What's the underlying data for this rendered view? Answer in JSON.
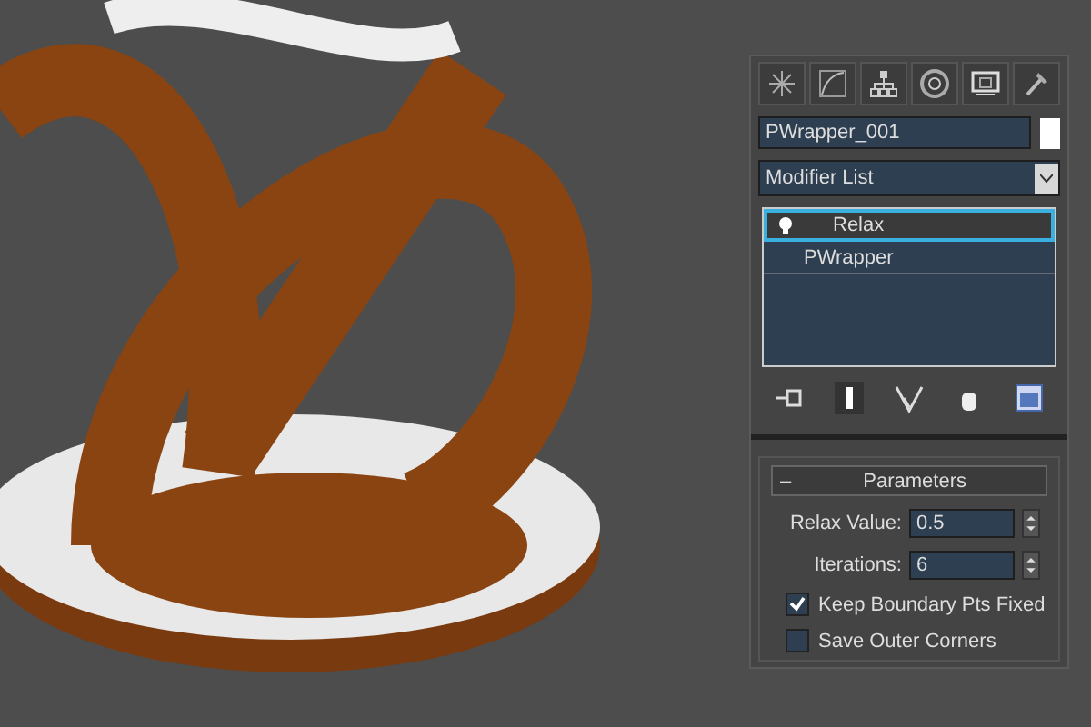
{
  "object_name": "PWrapper_001",
  "modifier_list": "Modifier List",
  "stack": [
    {
      "label": "Relax",
      "selected": true
    },
    {
      "label": "PWrapper",
      "selected": false
    }
  ],
  "rollout": {
    "toggle": "–",
    "title": "Parameters",
    "fields": [
      {
        "label": "Relax Value:",
        "value": "0.5"
      },
      {
        "label": "Iterations:",
        "value": "6"
      }
    ],
    "checkboxes": [
      {
        "label": "Keep Boundary Pts Fixed",
        "checked": true
      },
      {
        "label": "Save Outer Corners",
        "checked": false
      }
    ]
  }
}
